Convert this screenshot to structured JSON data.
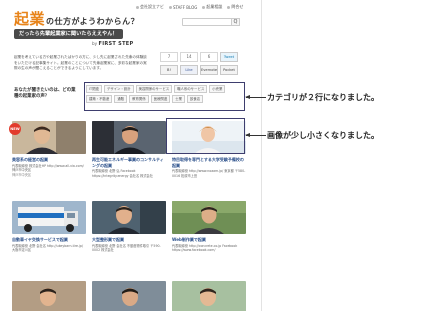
{
  "header": {
    "logo_kanji": "起業",
    "logo_rest": "の仕方がようわからん？",
    "tagline": "だったら先輩起業家に聞いたらええやん！",
    "by_prefix": "by",
    "brand": "FIRST STEP",
    "search_button": "Q"
  },
  "nav": [
    "会社設立ナビ",
    "STAFF BLOG",
    "起業相談",
    "問合せ"
  ],
  "intro": "起業を考えている方や起業されたばかりの方に、少し先に起業された先輩の体験談をいただける記事集サイト。起業のことについて先輩起業家に、多彩な起業家の実際の生の声が聞こえることができるようにしています。",
  "share": {
    "counts": [
      "7",
      "14",
      "6"
    ],
    "buttons": [
      "B!",
      "Like",
      "Evernote",
      "Pocket"
    ],
    "tweet": "Tweet"
  },
  "question": "あなたが聞きたいのは、どの業種の起業家の声？",
  "categories": [
    "IT関連",
    "デザイン・設計",
    "美容関係のサービス",
    "職人系のサービス",
    "小売業",
    "建築・不動産",
    "通販",
    "教育関係",
    "医療関連",
    "士業",
    "飲食店"
  ],
  "badge_new": "NEW",
  "cards": [
    {
      "title": "美容系の経営の起業",
      "desc": "代表取締役 株式会社HP http://www.all-via.com/ 神戸市中央区",
      "meta": "神戸市中央区"
    },
    {
      "title": "再生可能エネルギー事業のコンサルティングの起業",
      "desc": "代表取締役 北野 弘 Facebook https://integrity.energy 会社名 株式会社",
      "meta": ""
    },
    {
      "title": "特目取得を専門とする大学受験予備校の起業",
      "desc": "代表取締役 http://www.noaam.jp/ 東京都 〒580-0016 松原市上田",
      "meta": ""
    },
    {
      "title": "自動車イヤ交換サービスで起業",
      "desc": "代表取締役 北野 会社名 http://ukeybarn-tire.jp/ 大阪市淀川区",
      "meta": ""
    },
    {
      "title": "大型整形業で起業",
      "desc": "代表取締役 北野 会社名 不動産物件取引 〒590-0002 株式会社",
      "meta": ""
    },
    {
      "title": "Web制作業で起業",
      "desc": "代表取締役 http://concrete.co.jp Facebook https://www.facebook.com/",
      "meta": ""
    }
  ],
  "annotations": {
    "categories_note": "カテゴリが２行になりました。",
    "image_note": "画像が少し小さくなりました。"
  },
  "colors": {
    "accent": "#e8841a",
    "link": "#2a4f8a",
    "badge": "#e23b2c",
    "highlight": "#3e3e6e"
  }
}
